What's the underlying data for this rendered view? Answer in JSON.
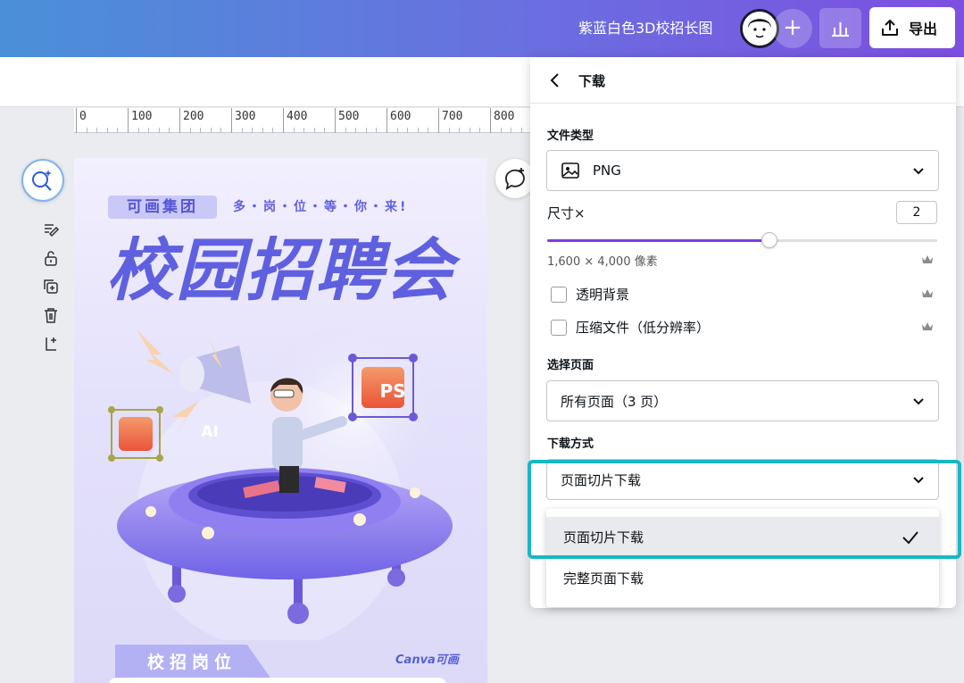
{
  "topbar": {
    "doc_title": "紫蓝白色3D校招长图",
    "export_label": "导出",
    "plus_symbol": "+"
  },
  "ruler": {
    "labels": [
      "0",
      "100",
      "200",
      "300",
      "400",
      "500",
      "600",
      "700",
      "800"
    ]
  },
  "poster": {
    "company_tag": "可画集团",
    "slogan": "多・岗・位・等・你・来!",
    "headline": "校园招聘会",
    "badge_ps": "PS",
    "badge_ai": "AI",
    "tab_label": "校招岗位",
    "brand": "Canva可画"
  },
  "panel": {
    "title": "下载",
    "file_type_label": "文件类型",
    "file_type_value": "PNG",
    "size_label": "尺寸×",
    "size_value": "2",
    "size_fraction": 0.57,
    "dimensions": "1,600 × 4,000 像素",
    "transparent_bg": "透明背景",
    "compress_file": "压缩文件（低分辨率）",
    "select_pages_label": "选择页面",
    "select_pages_value": "所有页面（3 页）",
    "download_method_label": "下载方式",
    "download_method_value": "页面切片下载",
    "menu_options": [
      "页面切片下载",
      "完整页面下载"
    ]
  },
  "colors": {
    "accent_purple": "#7d3be8",
    "highlight_teal": "#17b8c4",
    "poster_blue": "#5f60e0"
  }
}
